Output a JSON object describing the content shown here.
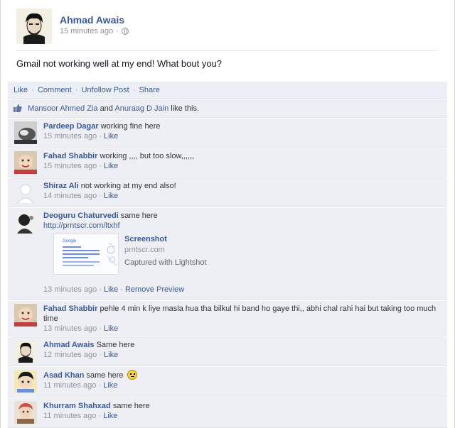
{
  "post": {
    "author": "Ahmad Awais",
    "time": "15 minutes ago",
    "meta_sep": "·",
    "status": "Gmail not working well at my end! What bout you?"
  },
  "actions": {
    "like": "Like",
    "comment": "Comment",
    "unfollow": "Unfollow Post",
    "share": "Share",
    "sep": "·"
  },
  "likes": {
    "person1": "Mansoor Ahmed Zia",
    "and": "and",
    "person2": "Anuraag D Jain",
    "suffix": "like this."
  },
  "comments": [
    {
      "name": "Pardeep Dagar",
      "text": "working fine here",
      "time": "15 minutes ago",
      "like": "Like",
      "sep": "·"
    },
    {
      "name": "Fahad Shabbir",
      "text": "working ,,,, but too slow,,,,,,",
      "time": "15 minutes ago",
      "like": "Like",
      "sep": "·"
    },
    {
      "name": "Shiraz Ali",
      "text": "not working at my end also!",
      "time": "14 minutes ago",
      "like": "Like",
      "sep": "·"
    },
    {
      "name": "Deoguru Chaturvedi",
      "text": "same here",
      "link": "http://prntscr.com/ltxhf",
      "time": "13 minutes ago",
      "like": "Like",
      "remove_preview": "Remove Preview",
      "sep": "·",
      "preview": {
        "title": "Screenshot",
        "domain": "prntscr.com",
        "desc": "Captured with Lightshot",
        "thumb_label": "Google"
      }
    },
    {
      "name": "Fahad Shabbir",
      "text": "pehle 4 min k liye masla hua tha bilkul hi band ho gaye thi,, abhi chal rahi hai but taking too much time",
      "time": "13 minutes ago",
      "like": "Like",
      "sep": "·"
    },
    {
      "name": "Ahmad Awais",
      "text": "Same here",
      "time": "12 minutes ago",
      "like": "Like",
      "sep": "·"
    },
    {
      "name": "Asad Khan",
      "text": "same here",
      "time": "11 minutes ago",
      "like": "Like",
      "sep": "·"
    },
    {
      "name": "Khurram Shahxad",
      "text": "same here",
      "time": "11 minutes ago",
      "like": "Like",
      "sep": "·"
    }
  ],
  "colors": {
    "link": "#3b5998",
    "panel": "#edeff4",
    "meta": "#90949c"
  }
}
